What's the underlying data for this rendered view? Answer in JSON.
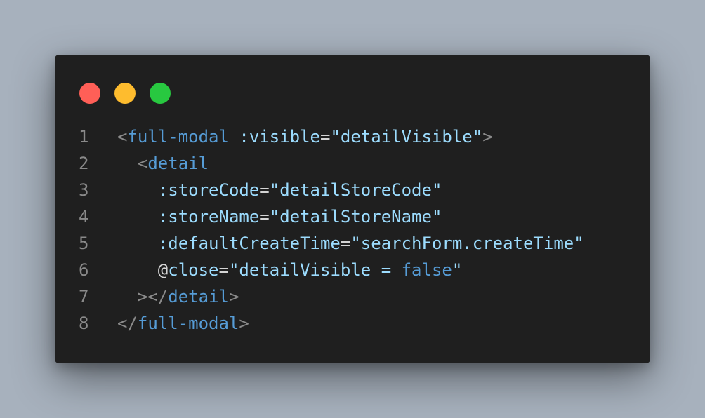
{
  "window": {
    "controls": [
      {
        "name": "close",
        "color": "#ff5f57"
      },
      {
        "name": "minimize",
        "color": "#febc2e"
      },
      {
        "name": "maximize",
        "color": "#28c840"
      }
    ]
  },
  "code": {
    "lines": [
      {
        "number": "1",
        "indent": "",
        "tokens": [
          {
            "t": "<",
            "c": "punct"
          },
          {
            "t": "full-modal",
            "c": "tag"
          },
          {
            "t": " ",
            "c": "plain"
          },
          {
            "t": ":visible",
            "c": "attr"
          },
          {
            "t": "=",
            "c": "plain"
          },
          {
            "t": "\"detailVisible\"",
            "c": "str"
          },
          {
            "t": ">",
            "c": "punct"
          }
        ]
      },
      {
        "number": "2",
        "indent": "  ",
        "tokens": [
          {
            "t": "<",
            "c": "punct"
          },
          {
            "t": "detail",
            "c": "tag"
          }
        ]
      },
      {
        "number": "3",
        "indent": "    ",
        "tokens": [
          {
            "t": ":storeCode",
            "c": "attr"
          },
          {
            "t": "=",
            "c": "plain"
          },
          {
            "t": "\"detailStoreCode\"",
            "c": "str"
          }
        ]
      },
      {
        "number": "4",
        "indent": "    ",
        "tokens": [
          {
            "t": ":storeName",
            "c": "attr"
          },
          {
            "t": "=",
            "c": "plain"
          },
          {
            "t": "\"detailStoreName\"",
            "c": "str"
          }
        ]
      },
      {
        "number": "5",
        "indent": "    ",
        "tokens": [
          {
            "t": ":defaultCreateTime",
            "c": "attr"
          },
          {
            "t": "=",
            "c": "plain"
          },
          {
            "t": "\"searchForm.createTime\"",
            "c": "str"
          }
        ]
      },
      {
        "number": "6",
        "indent": "    ",
        "tokens": [
          {
            "t": "@",
            "c": "at"
          },
          {
            "t": "close",
            "c": "attr"
          },
          {
            "t": "=",
            "c": "plain"
          },
          {
            "t": "\"detailVisible = ",
            "c": "str"
          },
          {
            "t": "false",
            "c": "kw"
          },
          {
            "t": "\"",
            "c": "str"
          }
        ]
      },
      {
        "number": "7",
        "indent": "  ",
        "tokens": [
          {
            "t": "></",
            "c": "punct"
          },
          {
            "t": "detail",
            "c": "tag"
          },
          {
            "t": ">",
            "c": "punct"
          }
        ]
      },
      {
        "number": "8",
        "indent": "",
        "tokens": [
          {
            "t": "</",
            "c": "punct"
          },
          {
            "t": "full-modal",
            "c": "tag"
          },
          {
            "t": ">",
            "c": "punct"
          }
        ]
      }
    ]
  }
}
